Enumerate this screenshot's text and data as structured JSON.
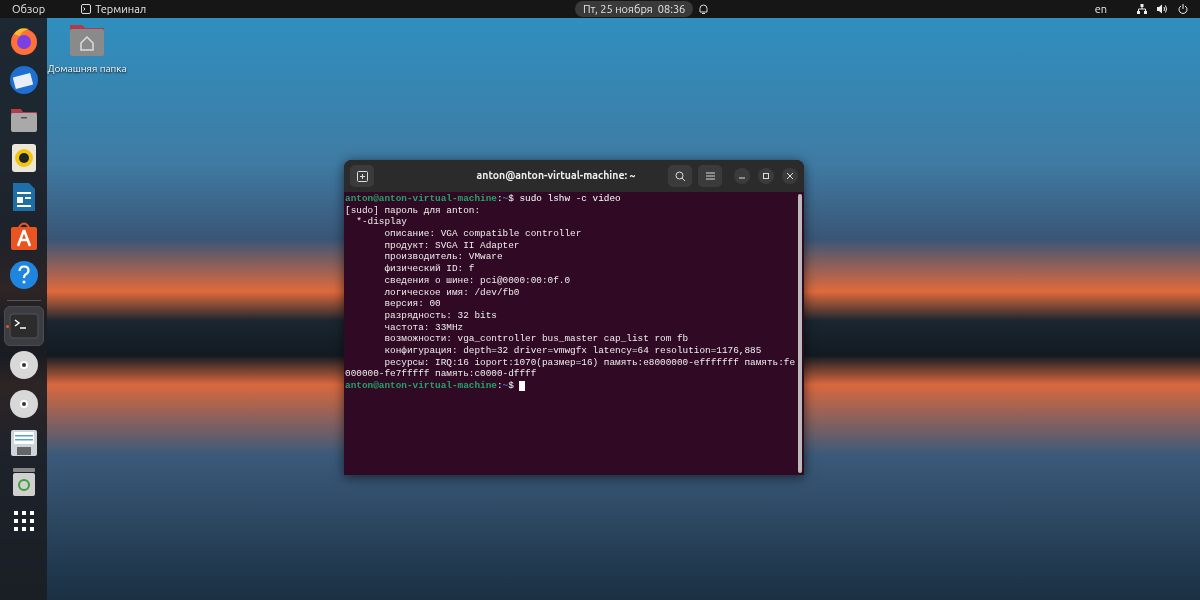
{
  "top_bar": {
    "activities": "Обзор",
    "app_menu": "Терминал",
    "clock": "Пт, 25 ноября  08:36",
    "language": "en"
  },
  "dock": [
    {
      "kind": "firefox",
      "selected": false
    },
    {
      "kind": "mail",
      "selected": false
    },
    {
      "kind": "files",
      "selected": false
    },
    {
      "kind": "music",
      "selected": false
    },
    {
      "kind": "writer",
      "selected": false
    },
    {
      "kind": "software",
      "selected": false
    },
    {
      "kind": "help",
      "selected": false
    },
    {
      "kind": "separator"
    },
    {
      "kind": "terminal",
      "selected": true
    },
    {
      "kind": "disc",
      "selected": false
    },
    {
      "kind": "disc",
      "selected": false
    },
    {
      "kind": "floppy",
      "selected": false
    },
    {
      "kind": "trash",
      "selected": false
    },
    {
      "kind": "apps",
      "selected": false
    }
  ],
  "desktop_icons": [
    {
      "label": "Домашняя папка"
    }
  ],
  "terminal": {
    "title": "anton@anton-virtual-machine: ~",
    "lines": [
      {
        "kind": "prompt",
        "user": "anton@anton-virtual-machine",
        "separator": ":",
        "path": "~",
        "symbol": "$",
        "command": "sudo lshw -c video"
      },
      {
        "kind": "output",
        "text": "[sudo] пароль для anton:"
      },
      {
        "kind": "output",
        "text": "  *-display"
      },
      {
        "kind": "output",
        "text": "       описание: VGA compatible controller"
      },
      {
        "kind": "output",
        "text": "       продукт: SVGA II Adapter"
      },
      {
        "kind": "output",
        "text": "       производитель: VMware"
      },
      {
        "kind": "output",
        "text": "       физический ID: f"
      },
      {
        "kind": "output",
        "text": "       сведения о шине: pci@0000:00:0f.0"
      },
      {
        "kind": "output",
        "text": "       логическое имя: /dev/fb0"
      },
      {
        "kind": "output",
        "text": "       версия: 00"
      },
      {
        "kind": "output",
        "text": "       разрядность: 32 bits"
      },
      {
        "kind": "output",
        "text": "       частота: 33MHz"
      },
      {
        "kind": "output",
        "text": "       возможности: vga_controller bus_master cap_list rom fb"
      },
      {
        "kind": "output",
        "text": "       конфигурация: depth=32 driver=vmwgfx latency=64 resolution=1176,885"
      },
      {
        "kind": "output",
        "text": "       ресурсы: IRQ:16 ioport:1070(размер=16) память:e8000000-efffffff память:fe"
      },
      {
        "kind": "output",
        "text": "000000-fe7fffff память:c0000-dffff"
      },
      {
        "kind": "prompt",
        "user": "anton@anton-virtual-machine",
        "separator": ":",
        "path": "~",
        "symbol": "$",
        "cursor": true
      }
    ]
  }
}
